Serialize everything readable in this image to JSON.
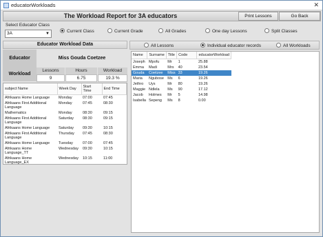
{
  "window": {
    "title": "educatorWorkloads"
  },
  "header": {
    "title": "The Workload Report for 3A educators",
    "print_label": "Print Lessons",
    "back_label": "Go Back"
  },
  "class_select": {
    "label": "Select Educator Class",
    "value": "3A"
  },
  "filters": {
    "current_class": "Current Class",
    "current_grade": "Current Grade",
    "all_grades": "All Grades",
    "one_day": "One day Lessons",
    "split": "Split Classes"
  },
  "workload": {
    "panel_title": "Educator Workload Data",
    "educator_label": "Educator",
    "educator_name": "Miss Gouda Coetzee",
    "workload_label": "Workload",
    "col_lessons": "Lessons",
    "col_hours": "Hours",
    "col_workload": "Workload",
    "lessons": "9",
    "hours": "6.75",
    "workload_pct": "19.3 %"
  },
  "lessons_table": {
    "headers": [
      "subject Name",
      "Week Day",
      "Start Time",
      "End Time"
    ],
    "rows": [
      [
        "Afrikaans Home Language",
        "Monday",
        "07:00",
        "07:45"
      ],
      [
        "Afrikaans First Additional Language",
        "Monday",
        "07:45",
        "08:30"
      ],
      [
        "Mathematics",
        "Monday",
        "08:30",
        "09:15"
      ],
      [
        "Afrikaans First Additional Language",
        "Saturday",
        "08:30",
        "09:15"
      ],
      [
        "Afrikaans Home Language",
        "Saturday",
        "09:30",
        "10:15"
      ],
      [
        "Afrikaans First Additional Language",
        "Thursday",
        "07:45",
        "08:30"
      ],
      [
        "Afrikaans Home Language",
        "Tuesday",
        "07:00",
        "07:45"
      ],
      [
        "Afrikaans Home Language_TT",
        "Wednesday",
        "09:30",
        "10:15"
      ],
      [
        "Afrikaans Home Language_EX",
        "Wednesday",
        "10:15",
        "11:00"
      ]
    ]
  },
  "right_filters": {
    "all_lessons": "All Lessons",
    "individual": "Individual educator records",
    "all_workloads": "All Workloads"
  },
  "educators_table": {
    "headers": [
      "Name",
      "Surname",
      "Title",
      "Code",
      "educatorWorkload"
    ],
    "rows": [
      [
        "Joseph",
        "Mpofu",
        "Mr",
        "1",
        "25.88"
      ],
      [
        "Emma",
        "Madi",
        "Mrs",
        "40",
        "23.54"
      ],
      [
        "Gouda",
        "Coetzee",
        "Miss",
        "33",
        "19.26"
      ],
      [
        "Maria",
        "Ngubose",
        "Ms",
        "6",
        "19.26"
      ],
      [
        "Jethro",
        "Uys",
        "Mr",
        "80",
        "19.26"
      ],
      [
        "Maggie",
        "Ndlela",
        "Ms",
        "90",
        "17.12"
      ],
      [
        "Jacob",
        "Holmes",
        "Mr",
        "5",
        "14.98"
      ],
      [
        "Isabella",
        "Sepeng",
        "Ms",
        "8",
        "0.00"
      ]
    ],
    "selected_index": 2
  }
}
